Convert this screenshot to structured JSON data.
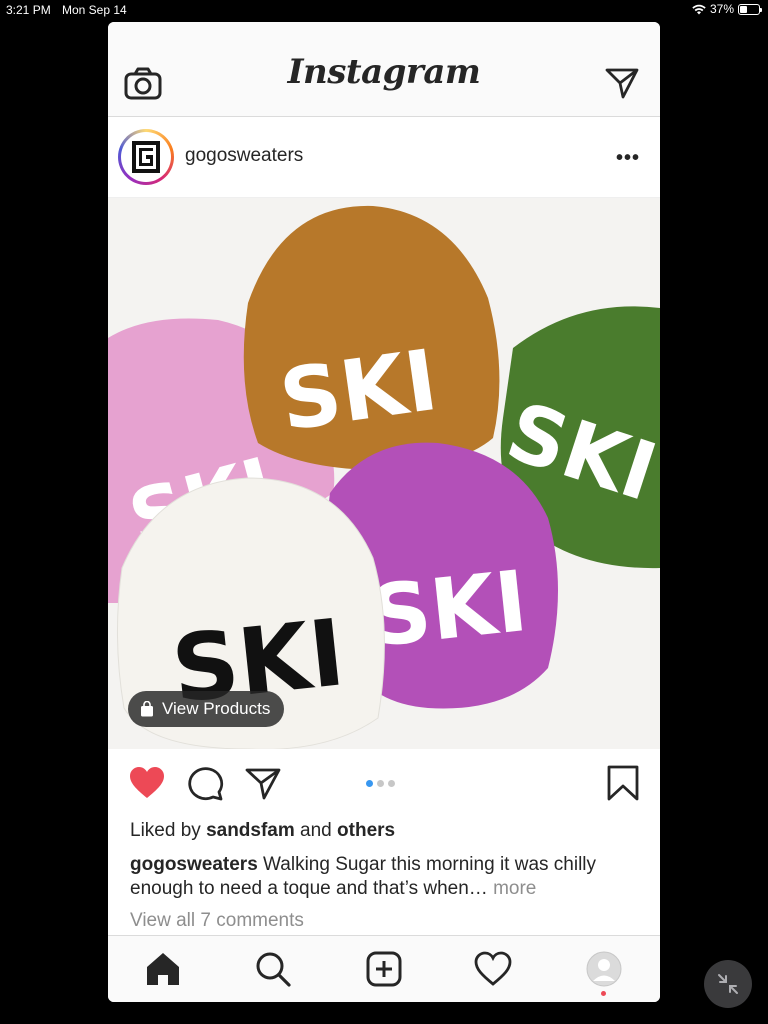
{
  "status_bar": {
    "time": "3:21 PM",
    "date": "Mon Sep 14",
    "battery": "37%",
    "battery_level": 0.37
  },
  "header": {
    "logo": "Instagram",
    "left_icon": "camera-icon",
    "right_icon": "direct-message-icon"
  },
  "post": {
    "username": "gogosweaters",
    "avatar_icon": "gogo-logo-icon",
    "options_icon": "more-options-icon",
    "view_products_label": "View Products",
    "photo": {
      "description_icon": "knit-hats-photo",
      "hats": [
        {
          "color": "#b7782a",
          "text": "SKI"
        },
        {
          "color": "#e6a2d0",
          "text": "SKI"
        },
        {
          "color": "#4a7c2d",
          "text": "SKI"
        },
        {
          "color": "#b350b8",
          "text": "SKI"
        },
        {
          "color": "#f5f3ee",
          "text": "SKI"
        }
      ]
    },
    "carousel": {
      "count": 3,
      "active_index": 0
    },
    "liked_by_prefix": "Liked by",
    "liked_by_user": "sandsfam",
    "liked_by_and": "and",
    "liked_by_others": "others",
    "caption_user": "gogosweaters",
    "caption_text": "Walking Sugar this morning it was chilly enough to need a toque and that’s when…",
    "caption_more": "more",
    "view_comments": "View all 7 comments",
    "liked": true
  },
  "tabbar": {
    "items": [
      {
        "name": "home",
        "icon": "home-icon",
        "active": true
      },
      {
        "name": "search",
        "icon": "search-icon"
      },
      {
        "name": "new-post",
        "icon": "add-post-icon"
      },
      {
        "name": "activity",
        "icon": "heart-outline-icon"
      },
      {
        "name": "profile",
        "icon": "profile-icon",
        "has_notification": true
      }
    ]
  },
  "colors": {
    "like_red": "#ed4956",
    "accent_blue": "#3897f0",
    "text": "#262626",
    "muted": "#8e8e8e"
  }
}
